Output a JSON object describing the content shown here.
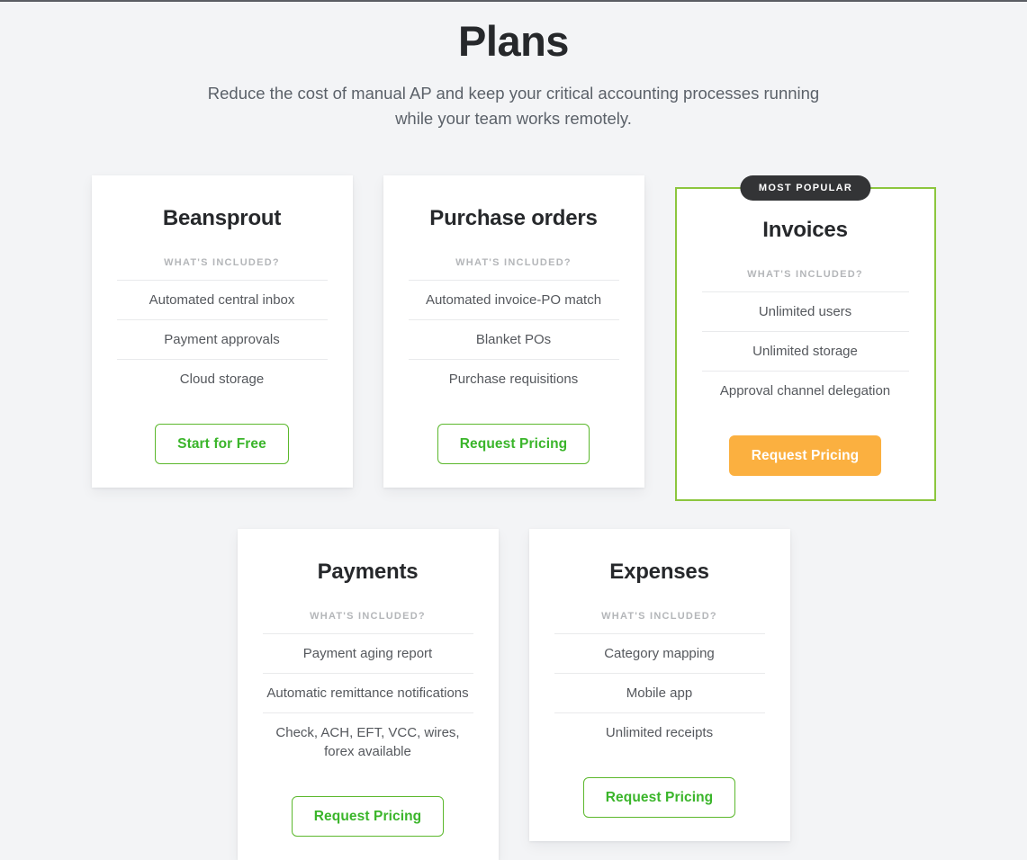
{
  "header": {
    "title": "Plans",
    "subtitle": "Reduce the cost of manual AP and keep your critical accounting processes running while your team works remotely."
  },
  "labels": {
    "included": "WHAT'S INCLUDED?",
    "most_popular_badge": "MOST POPULAR"
  },
  "colors": {
    "background": "#f3f4f6",
    "card_background": "#ffffff",
    "featured_border": "#8cc63e",
    "button_green": "#3ab52a",
    "button_orange": "#fbb040",
    "badge_dark": "#333436",
    "title_dark": "#26282b",
    "body_gray": "#55585d",
    "muted_gray": "#b4b6b9"
  },
  "rows": [
    {
      "cards": [
        {
          "name": "Beansprout",
          "featured": false,
          "features": [
            "Automated central inbox",
            "Payment approvals",
            "Cloud storage"
          ],
          "cta": {
            "label": "Start for Free",
            "style": "outline"
          }
        },
        {
          "name": "Purchase orders",
          "featured": false,
          "features": [
            "Automated invoice-PO match",
            "Blanket POs",
            "Purchase requisitions"
          ],
          "cta": {
            "label": "Request Pricing",
            "style": "outline"
          }
        },
        {
          "name": "Invoices",
          "featured": true,
          "badge": "MOST POPULAR",
          "features": [
            "Unlimited users",
            "Unlimited storage",
            "Approval channel delegation"
          ],
          "cta": {
            "label": "Request Pricing",
            "style": "solid"
          }
        }
      ]
    },
    {
      "cards": [
        {
          "name": "Payments",
          "featured": false,
          "features": [
            "Payment aging report",
            "Automatic remittance notifications",
            "Check, ACH, EFT, VCC, wires, forex available"
          ],
          "cta": {
            "label": "Request Pricing",
            "style": "outline"
          }
        },
        {
          "name": "Expenses",
          "featured": false,
          "features": [
            "Category mapping",
            "Mobile app",
            "Unlimited receipts"
          ],
          "cta": {
            "label": "Request Pricing",
            "style": "outline"
          }
        }
      ]
    }
  ]
}
